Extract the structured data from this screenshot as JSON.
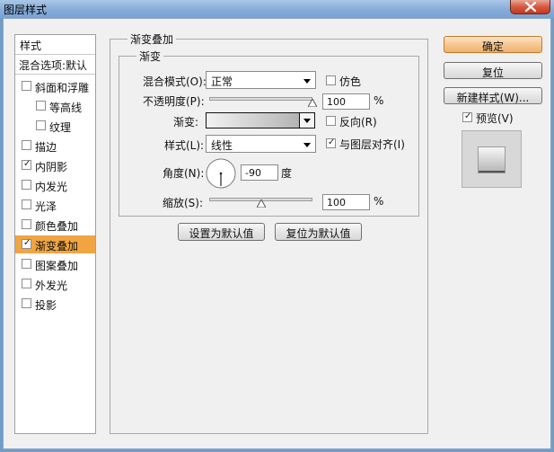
{
  "window": {
    "title": "图层样式"
  },
  "left_panel": {
    "header": "样式",
    "blend_options": "混合选项:默认",
    "items": [
      {
        "label": "斜面和浮雕",
        "checked": false,
        "indent": false,
        "active": false
      },
      {
        "label": "等高线",
        "checked": false,
        "indent": true,
        "active": false
      },
      {
        "label": "纹理",
        "checked": false,
        "indent": true,
        "active": false
      },
      {
        "label": "描边",
        "checked": false,
        "indent": false,
        "active": false
      },
      {
        "label": "内阴影",
        "checked": true,
        "indent": false,
        "active": false
      },
      {
        "label": "内发光",
        "checked": false,
        "indent": false,
        "active": false
      },
      {
        "label": "光泽",
        "checked": false,
        "indent": false,
        "active": false
      },
      {
        "label": "颜色叠加",
        "checked": false,
        "indent": false,
        "active": false
      },
      {
        "label": "渐变叠加",
        "checked": true,
        "indent": false,
        "active": true
      },
      {
        "label": "图案叠加",
        "checked": false,
        "indent": false,
        "active": false
      },
      {
        "label": "外发光",
        "checked": false,
        "indent": false,
        "active": false
      },
      {
        "label": "投影",
        "checked": false,
        "indent": false,
        "active": false
      }
    ]
  },
  "section": {
    "title": "渐变叠加",
    "group_title": "渐变",
    "blend_mode_label": "混合模式(O):",
    "blend_mode_value": "正常",
    "dither_label": "仿色",
    "dither_checked": false,
    "opacity_label": "不透明度(P):",
    "opacity_value": "100",
    "opacity_unit": "%",
    "opacity_percent": 100,
    "gradient_label": "渐变:",
    "reverse_label": "反向(R)",
    "reverse_checked": false,
    "style_label": "样式(L):",
    "style_value": "线性",
    "align_label": "与图层对齐(I)",
    "align_checked": true,
    "angle_label": "角度(N):",
    "angle_value": "-90",
    "angle_unit": "度",
    "angle_degrees": -90,
    "scale_label": "缩放(S):",
    "scale_value": "100",
    "scale_unit": "%",
    "scale_percent": 100,
    "set_default_button": "设置为默认值",
    "reset_default_button": "复位为默认值"
  },
  "right_panel": {
    "ok_button": "确定",
    "reset_button": "复位",
    "new_style_button": "新建样式(W)...",
    "preview_label": "预览(V)",
    "preview_checked": true
  },
  "colors": {
    "active_item": "#f0a542",
    "default_button": "#f6c891",
    "close_button": "#d5593f"
  }
}
